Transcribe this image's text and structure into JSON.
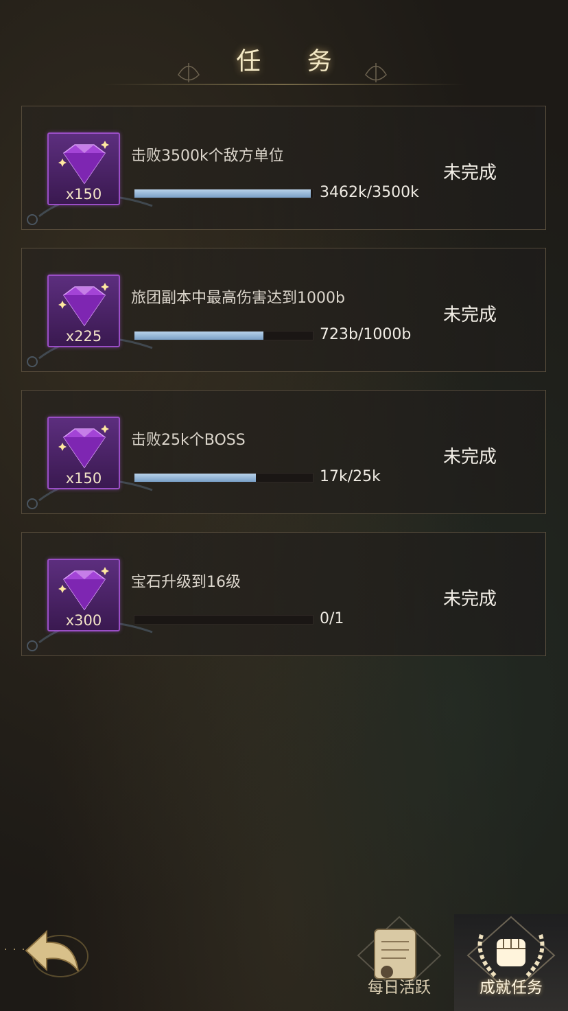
{
  "header": {
    "title": "任 务"
  },
  "tasks": [
    {
      "description": "击败3500k个敌方单位",
      "reward_qty": "x150",
      "progress_text": "3462k/3500k",
      "progress_fraction": 0.989,
      "status": "未完成"
    },
    {
      "description": "旅团副本中最高伤害达到1000b",
      "reward_qty": "x225",
      "progress_text": "723b/1000b",
      "progress_fraction": 0.723,
      "status": "未完成"
    },
    {
      "description": "击败25k个BOSS",
      "reward_qty": "x150",
      "progress_text": "17k/25k",
      "progress_fraction": 0.68,
      "status": "未完成"
    },
    {
      "description": "宝石升级到16级",
      "reward_qty": "x300",
      "progress_text": "0/1",
      "progress_fraction": 0,
      "status": "未完成"
    }
  ],
  "bottom_nav": {
    "daily_label": "每日活跃",
    "achievement_label": "成就任务"
  },
  "colors": {
    "gem": "#9a3fd0",
    "bar_fill": "#8fb2d6",
    "title_glow": "#f3e8c4"
  },
  "icons": {
    "reward": "purple-gem-icon",
    "back": "back-arrow-icon",
    "daily": "scroll-icon",
    "achievement": "fist-laurel-icon"
  }
}
